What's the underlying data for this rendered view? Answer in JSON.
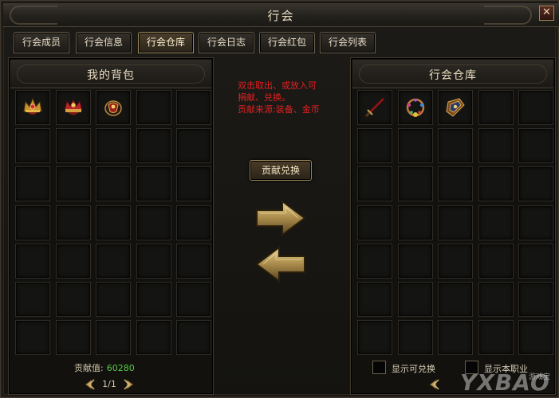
{
  "window": {
    "title": "行会",
    "close_icon": "close-icon"
  },
  "tabs": [
    {
      "label": "行会成员",
      "active": false
    },
    {
      "label": "行会信息",
      "active": false
    },
    {
      "label": "行会仓库",
      "active": true
    },
    {
      "label": "行会日志",
      "active": false
    },
    {
      "label": "行会红包",
      "active": false
    },
    {
      "label": "行会列表",
      "active": false
    }
  ],
  "my_bag": {
    "title": "我的背包",
    "items": [
      "crown-helmet-gold",
      "crown-helmet-red",
      "gauntlet-red"
    ],
    "contribution_label": "贡献值:",
    "contribution_value": "60280",
    "page": "1/1"
  },
  "center": {
    "instructions": [
      "双击取出、或放入可",
      "捐献、兑换。",
      "贡献来源:装备、金币"
    ],
    "exchange_button": "贡献兑换"
  },
  "guild_warehouse": {
    "title": "行会仓库",
    "items": [
      "red-sword",
      "jeweled-necklace",
      "ornate-bracer"
    ],
    "show_exchangeable": "显示可兑换",
    "show_own_class": "显示本职业"
  },
  "watermark": {
    "text": "YXBAO",
    "sub": "游戏宝"
  },
  "colors": {
    "instruction_red": "#e02020",
    "contribution_green": "#5ac84a",
    "gold_border": "#9a845a"
  }
}
